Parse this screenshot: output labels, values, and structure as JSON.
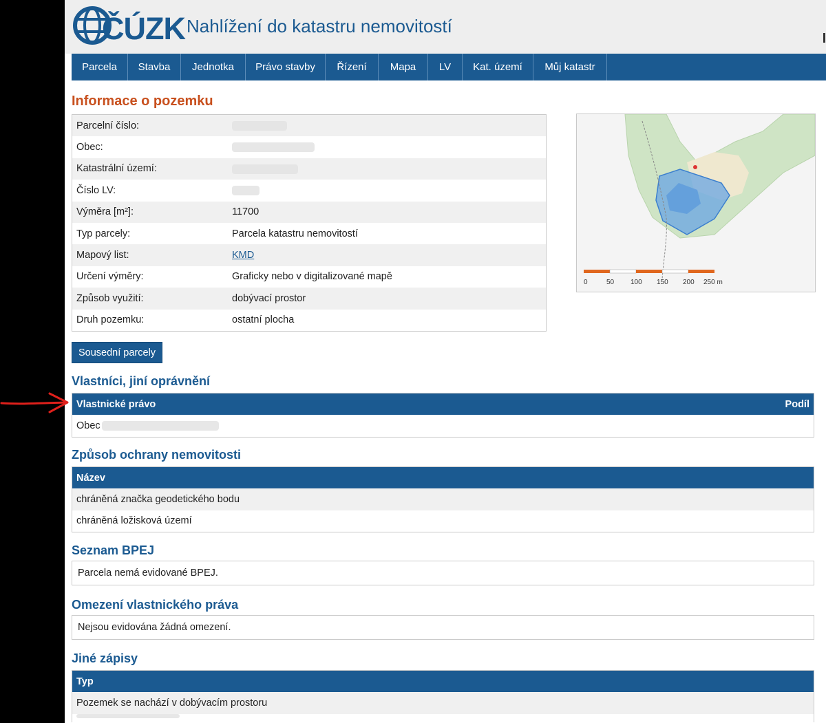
{
  "header": {
    "logo_text": "ČÚZK",
    "site_title": "Nahlížení do katastru nemovitostí"
  },
  "nav": [
    "Parcela",
    "Stavba",
    "Jednotka",
    "Právo stavby",
    "Řízení",
    "Mapa",
    "LV",
    "Kat. území",
    "Můj katastr"
  ],
  "info": {
    "title": "Informace o pozemku",
    "rows": [
      {
        "label": "Parcelní číslo:",
        "value": ""
      },
      {
        "label": "Obec:",
        "value": ""
      },
      {
        "label": "Katastrální území:",
        "value": ""
      },
      {
        "label": "Číslo LV:",
        "value": ""
      },
      {
        "label": "Výměra [m²]:",
        "value": "11700"
      },
      {
        "label": "Typ parcely:",
        "value": "Parcela katastru nemovitostí"
      },
      {
        "label": "Mapový list:",
        "value": "KMD"
      },
      {
        "label": "Určení výměry:",
        "value": "Graficky nebo v digitalizované mapě"
      },
      {
        "label": "Způsob využití:",
        "value": "dobývací prostor"
      },
      {
        "label": "Druh pozemku:",
        "value": "ostatní plocha"
      }
    ]
  },
  "map": {
    "scale_labels": [
      "0",
      "50",
      "100",
      "150",
      "200",
      "250 m"
    ]
  },
  "neighbors_button": "Sousední parcely",
  "owners": {
    "title": "Vlastníci, jiní oprávnění",
    "head_left": "Vlastnické právo",
    "head_right": "Podíl",
    "row": "Obec"
  },
  "protection": {
    "title": "Způsob ochrany nemovitosti",
    "head": "Název",
    "rows": [
      "chráněná značka geodetického bodu",
      "chráněná ložisková území"
    ]
  },
  "bpej": {
    "title": "Seznam BPEJ",
    "text": "Parcela nemá evidované BPEJ."
  },
  "restrictions": {
    "title": "Omezení vlastnického práva",
    "text": "Nejsou evidována žádná omezení."
  },
  "other": {
    "title": "Jiné zápisy",
    "head": "Typ",
    "rows": [
      "Pozemek se nachází v dobývacím prostoru"
    ]
  },
  "colors": {
    "brand_blue": "#1b5a91",
    "title_orange": "#c8501e",
    "arrow_red": "#e0201b"
  }
}
